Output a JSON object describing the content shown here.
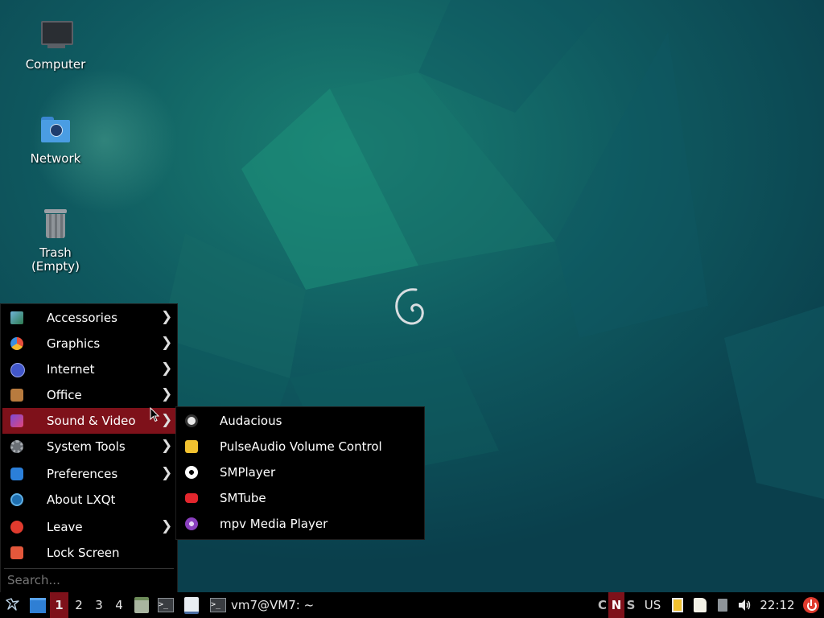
{
  "desktop": {
    "icons": [
      {
        "label": "Computer",
        "icon": "computer-icon"
      },
      {
        "label": "Network",
        "icon": "network-folder-icon"
      },
      {
        "label": "Trash",
        "sub": "(Empty)",
        "icon": "trash-icon"
      }
    ],
    "wallpaper": "debian-swirl-icon"
  },
  "menu": {
    "items": [
      {
        "label": "Accessories",
        "icon": "accessories-icon",
        "submenu": true
      },
      {
        "label": "Graphics",
        "icon": "graphics-icon",
        "submenu": true
      },
      {
        "label": "Internet",
        "icon": "internet-icon",
        "submenu": true
      },
      {
        "label": "Office",
        "icon": "office-briefcase-icon",
        "submenu": true
      },
      {
        "label": "Sound & Video",
        "icon": "multimedia-icon",
        "submenu": true,
        "active": true
      },
      {
        "label": "System Tools",
        "icon": "system-tools-gear-icon",
        "submenu": true
      },
      {
        "label": "Preferences",
        "icon": "preferences-icon",
        "submenu": true
      },
      {
        "label": "About LXQt",
        "icon": "lxqt-logo-icon",
        "submenu": false
      },
      {
        "label": "Leave",
        "icon": "power-icon",
        "submenu": true
      },
      {
        "label": "Lock Screen",
        "icon": "lock-icon",
        "submenu": false
      }
    ],
    "arrow": "❯",
    "search_placeholder": "Search..."
  },
  "submenu": {
    "items": [
      {
        "label": "Audacious",
        "icon": "audacious-icon"
      },
      {
        "label": "PulseAudio Volume Control",
        "icon": "pulseaudio-speaker-icon"
      },
      {
        "label": "SMPlayer",
        "icon": "smplayer-icon"
      },
      {
        "label": "SMTube",
        "icon": "smtube-play-icon"
      },
      {
        "label": "mpv Media Player",
        "icon": "mpv-icon"
      }
    ]
  },
  "taskbar": {
    "desktops": [
      "1",
      "2",
      "3",
      "4"
    ],
    "active_desktop": "1",
    "window_title": "vm7@VM7: ~",
    "locks": {
      "caps": "C",
      "num": "N",
      "scroll": "S"
    },
    "keyboard_layout": "US",
    "clock": "22:12",
    "colors": {
      "active": "#7e111a",
      "power": "#e03b2e"
    }
  }
}
